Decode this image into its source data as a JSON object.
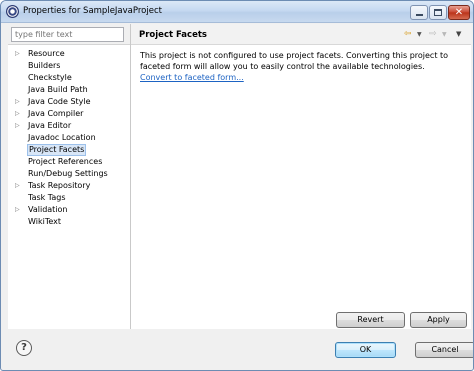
{
  "window": {
    "title": "Properties for SampleJavaProject",
    "minimize_icon": "minimize-icon",
    "maximize_icon": "maximize-icon",
    "close_icon": "close-icon",
    "close_color": "#c7442e"
  },
  "filter": {
    "placeholder": "type filter text"
  },
  "tree": {
    "items": [
      {
        "label": "Resource",
        "expandable": true
      },
      {
        "label": "Builders",
        "expandable": false
      },
      {
        "label": "Checkstyle",
        "expandable": false
      },
      {
        "label": "Java Build Path",
        "expandable": false
      },
      {
        "label": "Java Code Style",
        "expandable": true
      },
      {
        "label": "Java Compiler",
        "expandable": true
      },
      {
        "label": "Java Editor",
        "expandable": true
      },
      {
        "label": "Javadoc Location",
        "expandable": false
      },
      {
        "label": "Project Facets",
        "expandable": false,
        "selected": true
      },
      {
        "label": "Project References",
        "expandable": false
      },
      {
        "label": "Run/Debug Settings",
        "expandable": false
      },
      {
        "label": "Task Repository",
        "expandable": true
      },
      {
        "label": "Task Tags",
        "expandable": false
      },
      {
        "label": "Validation",
        "expandable": true
      },
      {
        "label": "WikiText",
        "expandable": false
      }
    ]
  },
  "page": {
    "title": "Project Facets",
    "description": "This project is not configured to use project facets. Converting this project to faceted form will allow you to easily control the available technologies.",
    "link": "Convert to faceted form...",
    "nav": {
      "back_icon": "back-arrow-icon",
      "forward_icon": "forward-arrow-icon",
      "menu_icon": "view-menu-icon"
    }
  },
  "buttons": {
    "revert": "Revert",
    "apply": "Apply",
    "ok": "OK",
    "cancel": "Cancel"
  },
  "help": {
    "glyph": "?",
    "icon": "help-icon"
  },
  "colors": {
    "link": "#1d63c3",
    "selection": "#d8e6f7",
    "accent": "#3c7fb1"
  }
}
